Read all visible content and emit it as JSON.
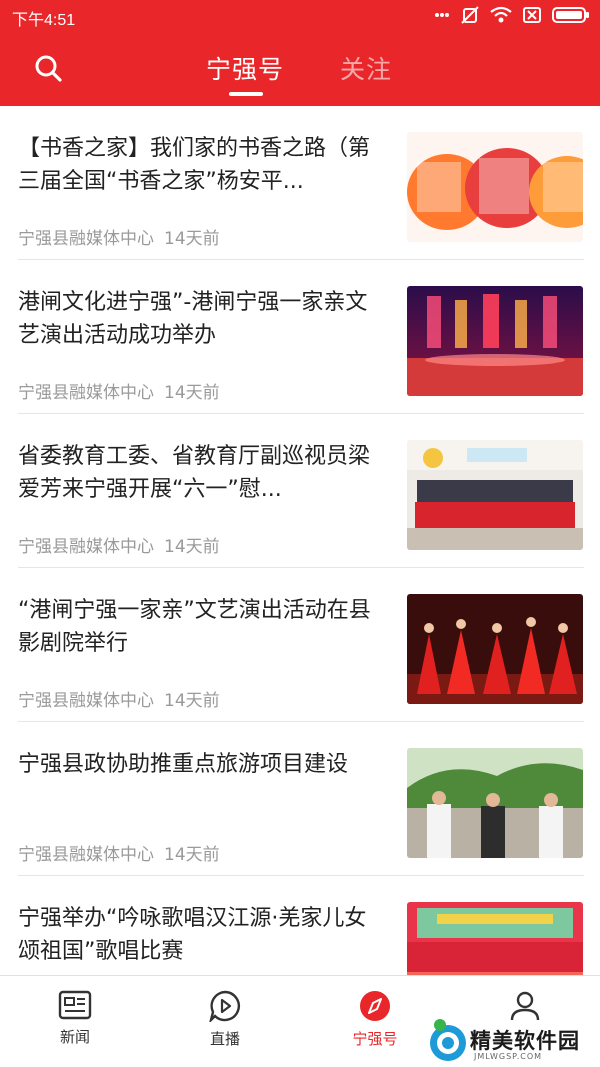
{
  "status_bar": {
    "time": "下午4:51"
  },
  "top_nav": {
    "tabs": [
      {
        "label": "宁强号",
        "active": true
      },
      {
        "label": "关注",
        "active": false
      }
    ]
  },
  "feed": {
    "items": [
      {
        "title": "【书香之家】我们家的书香之路（第三届全国“书香之家”杨安平...",
        "source": "宁强县融媒体中心",
        "time": "14天前",
        "thumb": "banner-书香满园"
      },
      {
        "title": "港闸文化进宁强”-港闸宁强一家亲文艺演出活动成功举办",
        "source": "宁强县融媒体中心",
        "time": "14天前",
        "thumb": "stage-performance"
      },
      {
        "title": "省委教育工委、省教育厅副巡视员梁爱芳来宁强开展“六一”慰...",
        "source": "宁强县融媒体中心",
        "time": "14天前",
        "thumb": "group-photo-children"
      },
      {
        "title": "“港闸宁强一家亲”文艺演出活动在县影剧院举行",
        "source": "宁强县融媒体中心",
        "time": "14天前",
        "thumb": "dancers-red-dress"
      },
      {
        "title": "宁强县政协助推重点旅游项目建设",
        "source": "宁强县融媒体中心",
        "time": "14天前",
        "thumb": "officials-outdoor"
      },
      {
        "title": "宁强举办“吟咏歌唱汉江源·羌家儿女颂祖国”歌唱比赛",
        "source": "",
        "time": "",
        "thumb": "singing-contest-stage"
      }
    ]
  },
  "bottom_nav": {
    "items": [
      {
        "label": "新闻",
        "icon": "newspaper-icon",
        "active": false
      },
      {
        "label": "直播",
        "icon": "play-bubble-icon",
        "active": false
      },
      {
        "label": "宁强号",
        "icon": "compass-icon",
        "active": true
      },
      {
        "label": "",
        "icon": "profile-icon",
        "active": false
      }
    ]
  },
  "watermark": {
    "label": "精美软件园",
    "sub": "JMLWGSP.COM"
  },
  "colors": {
    "brand_red": "#e9262a",
    "text_primary": "#222222",
    "text_meta": "#9a9a9a"
  }
}
